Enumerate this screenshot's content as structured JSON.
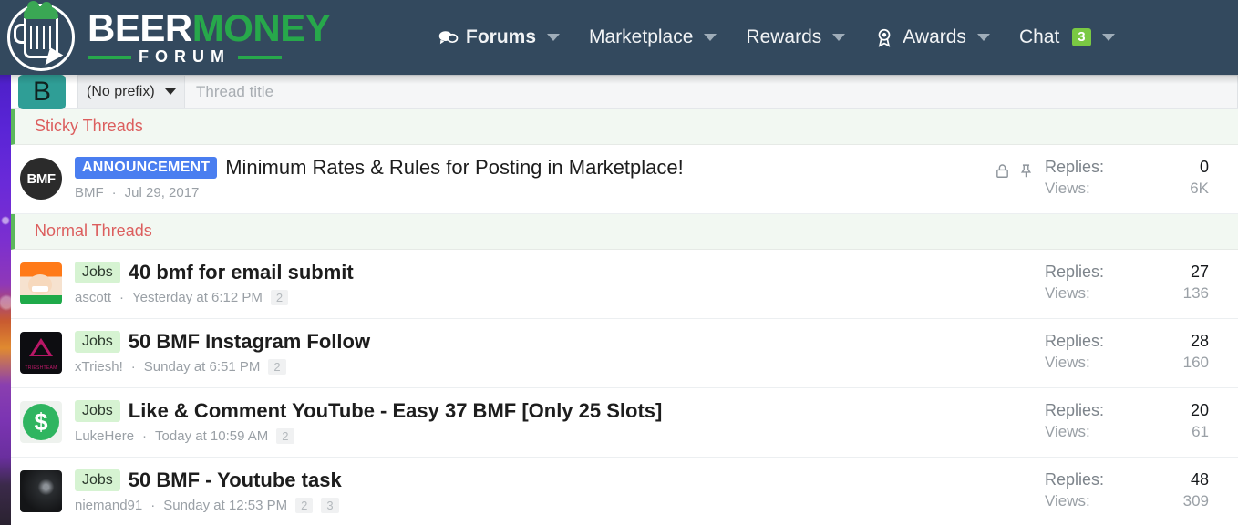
{
  "brand": {
    "name_part1": "BEER",
    "name_part2": "MONEY",
    "subtitle": "FORUM",
    "accent_green": "#27a84b",
    "header_bg": "#33495e"
  },
  "nav": {
    "items": [
      {
        "label": "Forums",
        "icon": "forums-icon",
        "active": true,
        "caret": true,
        "badge": null
      },
      {
        "label": "Marketplace",
        "icon": null,
        "active": false,
        "caret": true,
        "badge": null
      },
      {
        "label": "Rewards",
        "icon": null,
        "active": false,
        "caret": true,
        "badge": null
      },
      {
        "label": "Awards",
        "icon": "award-icon",
        "active": false,
        "caret": true,
        "badge": null
      },
      {
        "label": "Chat",
        "icon": null,
        "active": false,
        "caret": true,
        "badge": "3"
      }
    ],
    "badge_color": "#7ac943"
  },
  "create_thread": {
    "avatar_letter": "B",
    "prefix_value": "(No prefix)",
    "title_placeholder": "Thread title"
  },
  "sections": [
    {
      "label": "Sticky Threads"
    },
    {
      "label": "Normal Threads"
    }
  ],
  "sticky_threads": [
    {
      "avatar": "bmf-logo-avatar",
      "avatar_text": "BMF",
      "prefix": "ANNOUNCEMENT",
      "prefix_type": "announcement",
      "title": "Minimum Rates & Rules for Posting in Marketplace!",
      "author": "BMF",
      "date": "Jul 29, 2017",
      "pages": [],
      "locked": true,
      "pinned": true,
      "replies_label": "Replies:",
      "replies_value": "0",
      "views_label": "Views:",
      "views_value": "6K"
    }
  ],
  "normal_threads": [
    {
      "avatar": "ascott-avatar",
      "prefix": "Jobs",
      "prefix_type": "jobs",
      "title": "40 bmf for email submit",
      "author": "ascott",
      "date": "Yesterday at 6:12 PM",
      "pages": [
        "2"
      ],
      "replies_label": "Replies:",
      "replies_value": "27",
      "views_label": "Views:",
      "views_value": "136"
    },
    {
      "avatar": "triesh-avatar",
      "prefix": "Jobs",
      "prefix_type": "jobs",
      "title": "50 BMF Instagram Follow",
      "author": "xTriesh!",
      "date": "Sunday at 6:51 PM",
      "pages": [
        "2"
      ],
      "replies_label": "Replies:",
      "replies_value": "28",
      "views_label": "Views:",
      "views_value": "160"
    },
    {
      "avatar": "dollar-avatar",
      "prefix": "Jobs",
      "prefix_type": "jobs",
      "title": "Like & Comment YouTube - Easy 37 BMF [Only 25 Slots]",
      "author": "LukeHere",
      "date": "Today at 10:59 AM",
      "pages": [
        "2"
      ],
      "replies_label": "Replies:",
      "replies_value": "20",
      "views_label": "Views:",
      "views_value": "61"
    },
    {
      "avatar": "dark-photo-avatar",
      "prefix": "Jobs",
      "prefix_type": "jobs",
      "title": "50 BMF - Youtube task",
      "author": "niemand91",
      "date": "Sunday at 12:53 PM",
      "pages": [
        "2",
        "3"
      ],
      "replies_label": "Replies:",
      "replies_value": "48",
      "views_label": "Views:",
      "views_value": "309"
    }
  ],
  "separators": {
    "author_date": "·"
  }
}
